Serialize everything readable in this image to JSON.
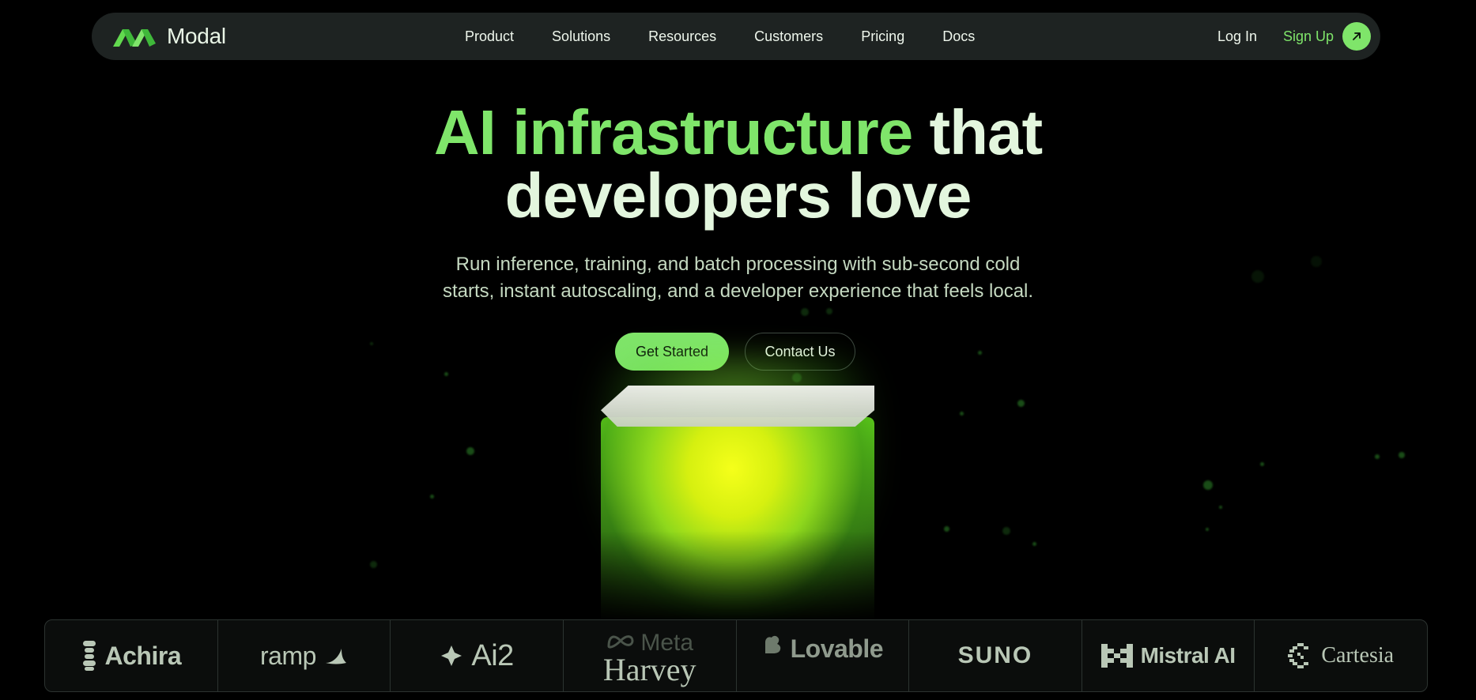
{
  "brand": {
    "name": "Modal",
    "icon": "modal-logo-icon"
  },
  "nav": {
    "items": [
      "Product",
      "Solutions",
      "Resources",
      "Customers",
      "Pricing",
      "Docs"
    ],
    "login": "Log In",
    "signup": "Sign Up",
    "signup_icon": "arrow-up-right-icon"
  },
  "hero": {
    "headline_accent": "AI infrastructure",
    "headline_rest": "that",
    "headline_line2": "developers love",
    "sub_line1": "Run inference, training, and batch processing with sub-second cold",
    "sub_line2": "starts, instant autoscaling, and a developer experience that feels local.",
    "primary_cta": "Get Started",
    "secondary_cta": "Contact Us"
  },
  "logos": {
    "achira": "Achira",
    "ramp": "ramp",
    "ai2": "Ai2",
    "meta": "Meta",
    "harvey": "Harvey",
    "lovable": "Lovable",
    "suno": "SUNO",
    "mistral": "Mistral AI",
    "cartesia": "Cartesia"
  },
  "colors": {
    "accent": "#7fe56a",
    "nav_bg": "#1e2322",
    "background": "#000000"
  }
}
